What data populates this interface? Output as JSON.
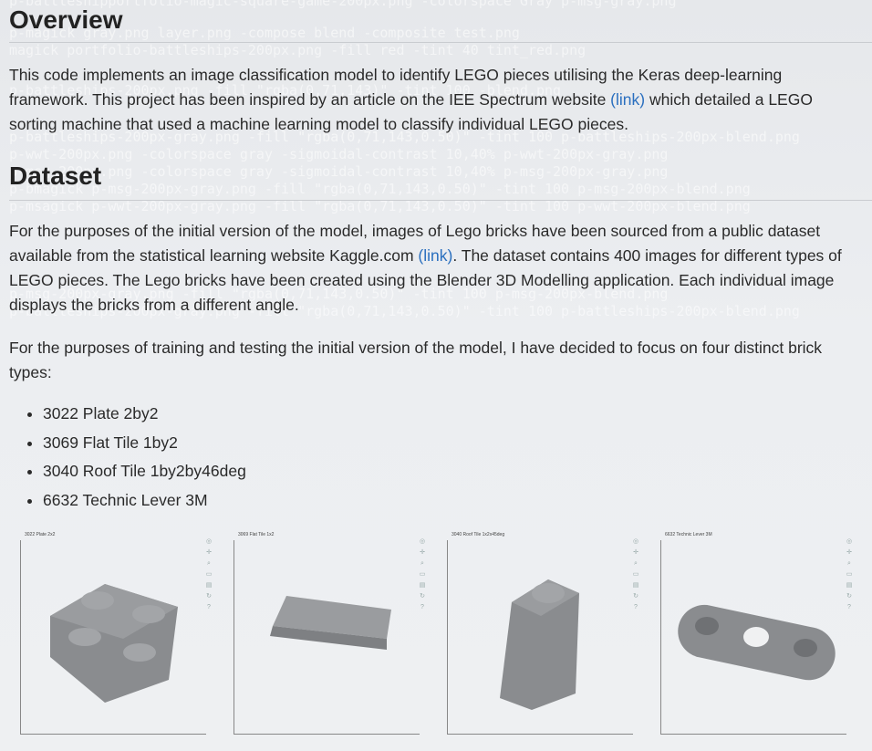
{
  "background_terminal": [
    "p-battleshipportfolio-magic-square-game-200px.png -colorspace Gray p-msg-gray.png",
    "p-magick gray.png layer.png -compose blend -composite test.png",
    "magick portfolio-battleships-200px.png  -fill red  -tint 40 tint_red.png",
    "p-battleships-200px.png -fill \"rgba(0,71,143)\" -tint 100 -blend.png",
    "p-battleships-200px-gray.png -fill \"rgba(0,71,143,0.50)\" -tint 100 p-battleships-200px-blend.png",
    "p-wwt-200px.png -colorspace gray -sigmoidal-contrast 10,40%  p-wwt-200px-gray.png",
    "p-msg-200px.png -colorspace gray -sigmoidal-contrast 10,40%  p-msg-200px-gray.png",
    "p-bmagick p-msg-200px-gray.png -fill \"rgba(0,71,143,0.50)\" -tint 100 p-msg-200px-blend.png",
    "p-msagick p-wwt-200px-gray.png -fill \"rgba(0,71,143,0.50)\" -tint 100 p-wwt-200px-blend.png",
    "p-msg-200px-gray.png -fill \"rgba(0,71,143,0.50)\" -tint 100 p-msg-200px-blend.png",
    "p-battleships-200px-gray.png -fill \"rgba(0,71,143,0.50)\" -tint 100 p-battleships-200px-blend.png"
  ],
  "overview": {
    "heading": "Overview",
    "text_before_link": "This code implements an image classification model to identify LEGO pieces utilising the Keras deep-learning framework. This project has been inspired by an article on the IEE Spectrum website ",
    "link_label": "(link)",
    "text_after_link": " which detailed a LEGO sorting machine that used a machine learning model to classify individual LEGO pieces."
  },
  "dataset": {
    "heading": "Dataset",
    "p1_before_link": "For the purposes of the initial version of the model, images of Lego bricks have been sourced from a public dataset available from the statistical learning website Kaggle.com ",
    "p1_link_label": "(link)",
    "p1_after_link": ". The dataset contains 400 images for different types of LEGO pieces. The Lego bricks have been created using the Blender 3D Modelling application. Each individual image displays the bricks from a different angle.",
    "p2": "For the purposes of training and testing the initial version of the model, I have decided to focus on four distinct brick types:",
    "bricks": [
      "3022 Plate 2by2",
      "3069 Flat Tile 1by2",
      "3040 Roof Tile 1by2by46deg",
      "6632 Technic Lever 3M"
    ]
  },
  "images": [
    {
      "title": "3022 Plate 2x2"
    },
    {
      "title": "3069 Flat Tile 1x2"
    },
    {
      "title": "3040 Roof Tile 1x2x45deg"
    },
    {
      "title": "6632 Technic Lever 3M"
    }
  ],
  "colors": {
    "link": "#2a6fbf",
    "brick": "#8a8c8f",
    "heading": "#222222"
  }
}
